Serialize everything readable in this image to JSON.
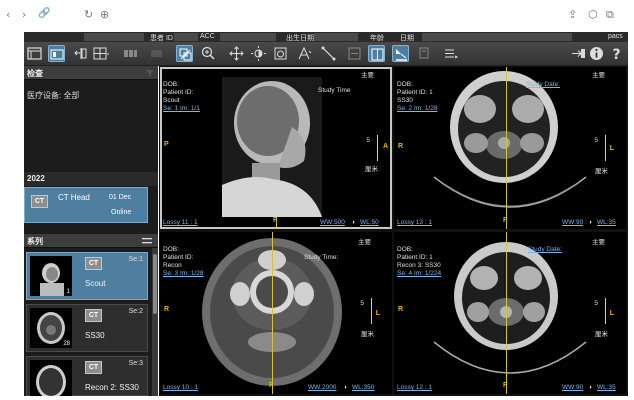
{
  "browser": {
    "icons": [
      "chevron-left-icon",
      "chevron-right-icon",
      "link-icon",
      "reload-icon",
      "globe-icon",
      "share-icon",
      "cube-icon",
      "window-icon"
    ]
  },
  "patient_strip": {
    "patient_id_label": "患者 ID",
    "accession_label": "ACC",
    "birthdate_label": "出生日期",
    "age_label": "年龄",
    "date_label": "日期",
    "system": "pacs"
  },
  "toolbar": {
    "tools": [
      "layout-icon",
      "series-icon",
      "split-icon",
      "grid-icon",
      "sync-icon",
      "link-icon",
      "zoom-icon",
      "pan-icon",
      "brightness-icon",
      "snapshot-icon",
      "measure-icon",
      "line-icon",
      "frame-icon",
      "reference-icon",
      "list-icon",
      "export-icon",
      "info-icon",
      "help-icon"
    ]
  },
  "left_panel": {
    "exam_header": "检查",
    "modality_filter": "医疗设备: 全部",
    "year": "2022",
    "study": {
      "modality": "CT",
      "description": "CT Head",
      "date": "01 Dec",
      "status": "Online"
    },
    "series_header": "系列",
    "series": [
      {
        "modality": "CT",
        "se": "Se:1",
        "name": "Scout",
        "count": "1",
        "selected": true
      },
      {
        "modality": "CT",
        "se": "Se:2",
        "name": "SS30",
        "count": "28",
        "selected": false
      },
      {
        "modality": "CT",
        "se": "Se:3",
        "name": "Recon 2: SS30",
        "count": "",
        "selected": false
      }
    ]
  },
  "viewports": [
    {
      "dob": "DOB:",
      "patient_id": "Patient ID:",
      "series_name": "Scout",
      "se_im": "Se: 1  Im: 1/1",
      "study_time": "Study Time",
      "label_top": "主要",
      "orient_left": "P",
      "orient_right": "A",
      "orient_bottom": "F",
      "scale": "5",
      "scale_unit": "厘米",
      "lossy": "Lossy 11 : 1",
      "ww": "WW:500",
      "wl": "WL:50",
      "active": true
    },
    {
      "dob": "DOB:",
      "patient_id": "Patient ID: 1",
      "series_name": "SS30",
      "se_im": "Se: 2  Im: 1/28",
      "study_time": "Study Date:",
      "label_top": "主要",
      "orient_left": "R",
      "orient_right": "L",
      "orient_bottom": "F",
      "scale": "5",
      "scale_unit": "厘米",
      "lossy": "Lossy 13 : 1",
      "ww": "WW:90",
      "wl": "WL:35",
      "active": false
    },
    {
      "dob": "DOB:",
      "patient_id": "Patient ID:",
      "series_name": "Recon",
      "se_im": "Se: 3  Im: 1/28",
      "study_time": "Study Time:",
      "label_top": "主要",
      "orient_left": "R",
      "orient_right": "L",
      "orient_bottom": "F",
      "scale": "5",
      "scale_unit": "厘米",
      "lossy": "Lossy 10 : 1",
      "ww": "WW:2000",
      "wl": "WL:350",
      "active": false
    },
    {
      "dob": "DOB:",
      "patient_id": "Patient ID: 1",
      "series_name": "Recon 3: SS30",
      "se_im": "Se: 4  Im: 1/224",
      "study_time": "Study Date:",
      "label_top": "主要",
      "orient_left": "R",
      "orient_right": "L",
      "orient_bottom": "F",
      "scale": "5",
      "scale_unit": "厘米",
      "lossy": "Lossy 12 : 1",
      "ww": "WW:90",
      "wl": "WL:35",
      "active": false
    }
  ]
}
